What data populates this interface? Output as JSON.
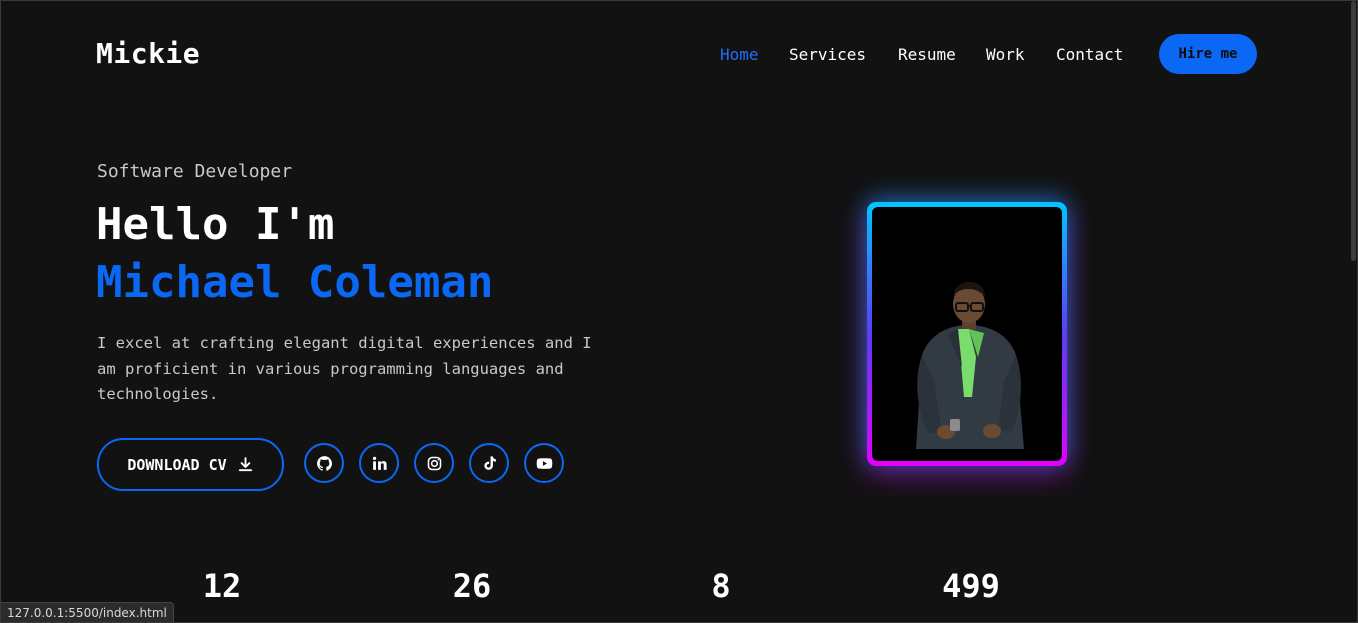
{
  "header": {
    "logo": "Mickie",
    "nav": [
      {
        "label": "Home",
        "active": true
      },
      {
        "label": "Services",
        "active": false
      },
      {
        "label": "Resume",
        "active": false
      },
      {
        "label": "Work",
        "active": false
      },
      {
        "label": "Contact",
        "active": false
      }
    ],
    "hire_label": "Hire me"
  },
  "hero": {
    "subtitle": "Software Developer",
    "greeting": "Hello I'm",
    "name": "Michael Coleman",
    "description": "I excel at crafting elegant digital experiences and I am proficient in various programming languages and technologies.",
    "download_label": "DOWNLOAD CV",
    "socials": [
      "github-icon",
      "linkedin-icon",
      "instagram-icon",
      "tiktok-icon",
      "youtube-icon"
    ]
  },
  "stats": [
    "12",
    "26",
    "8",
    "499"
  ],
  "status_url": "127.0.0.1:5500/index.html",
  "colors": {
    "background": "#121212",
    "accent": "#0a68f5",
    "text": "#ffffff",
    "muted_text": "#c9c9c9",
    "gradient_top": "#00c6ff",
    "gradient_bottom": "#e400ff"
  }
}
